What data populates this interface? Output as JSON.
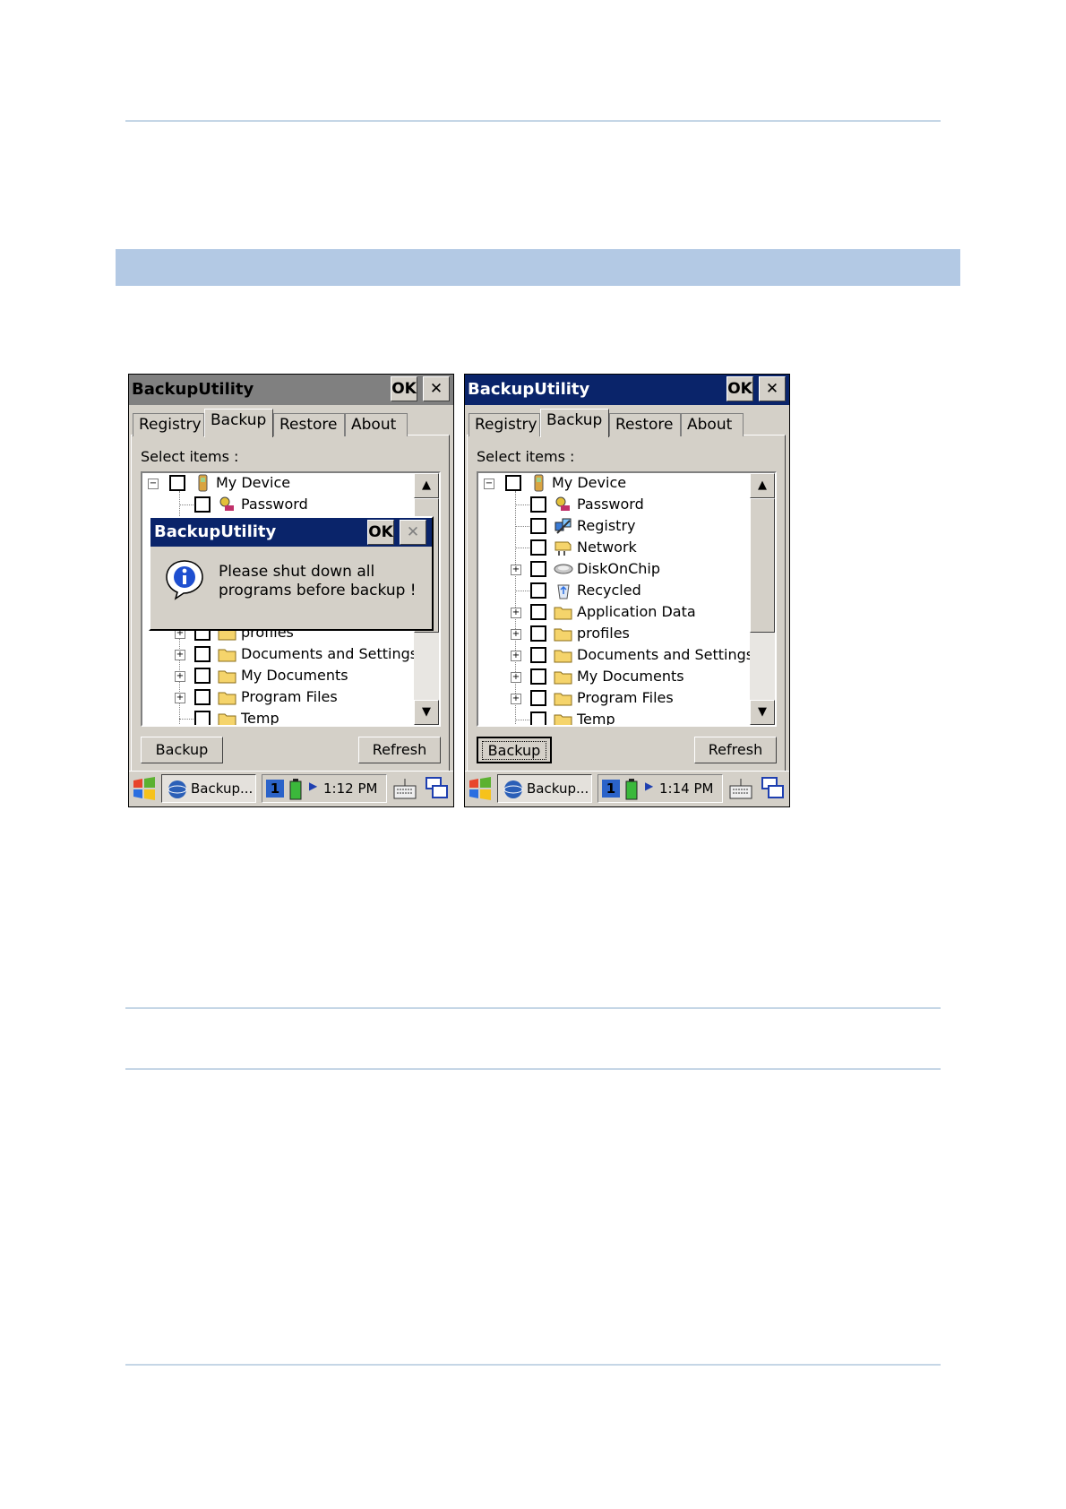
{
  "screens": [
    {
      "id": "left",
      "title": "BackupUtility",
      "ok": "OK",
      "close": "✕",
      "tabs": [
        "Registry",
        "Backup",
        "Restore",
        "About"
      ],
      "select_label": "Select items :",
      "tree_items": [
        "My Device",
        "Password",
        "profiles",
        "Documents and Settings",
        "My Documents",
        "Program Files",
        "Temp"
      ],
      "buttons": {
        "backup": "Backup",
        "refresh": "Refresh"
      },
      "task_label": "Backup...",
      "tray_num": "1",
      "time": "1:12 PM",
      "dialog": {
        "title": "BackupUtility",
        "ok": "OK",
        "close": "✕",
        "line1": "Please shut down all",
        "line2": "programs before backup !"
      }
    },
    {
      "id": "right",
      "title": "BackupUtility",
      "ok": "OK",
      "close": "✕",
      "tabs": [
        "Registry",
        "Backup",
        "Restore",
        "About"
      ],
      "select_label": "Select items :",
      "tree_items": [
        "My Device",
        "Password",
        "Registry",
        "Network",
        "DiskOnChip",
        "Recycled",
        "Application Data",
        "profiles",
        "Documents and Settings",
        "My Documents",
        "Program Files",
        "Temp"
      ],
      "buttons": {
        "backup": "Backup",
        "refresh": "Refresh"
      },
      "task_label": "Backup...",
      "tray_num": "1",
      "time": "1:14 PM"
    }
  ],
  "colors": {
    "active_title": "#0a246a",
    "inactive_title": "#808080",
    "band": "#b3c9e4",
    "folder": "#f5d46b"
  }
}
